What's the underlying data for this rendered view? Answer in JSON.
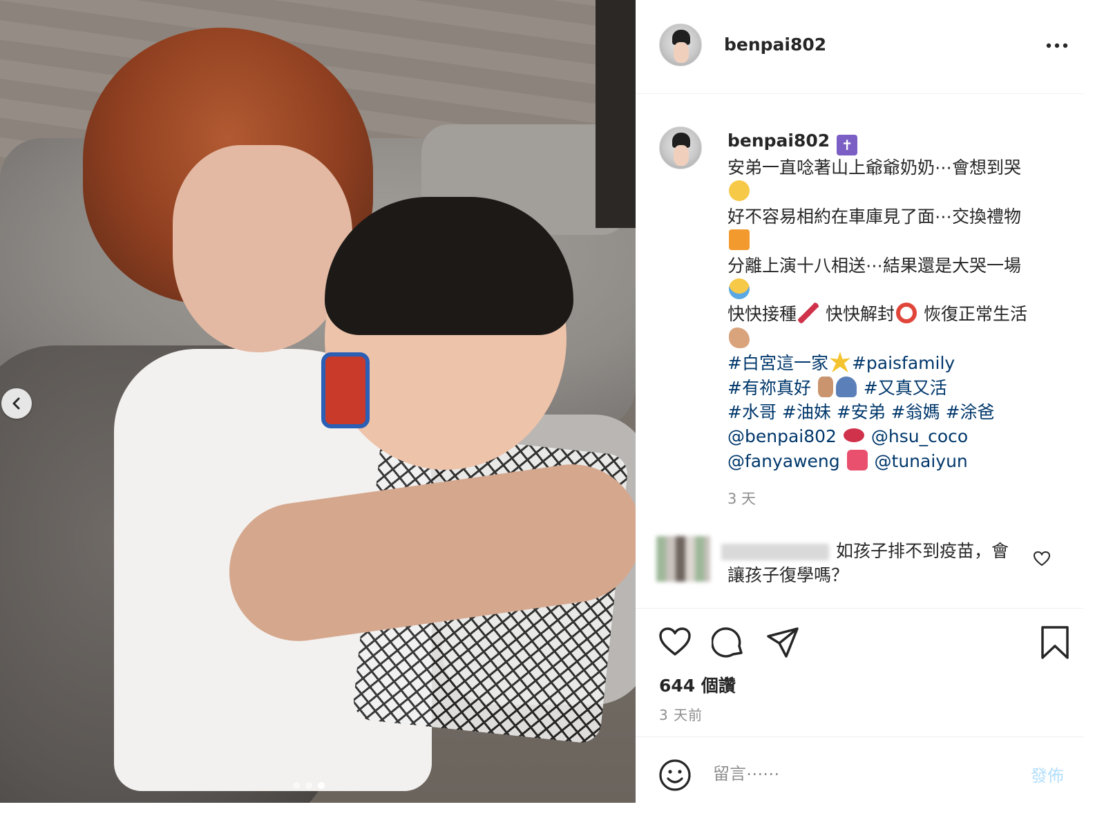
{
  "post": {
    "username": "benpai802",
    "more_label": "•••",
    "caption_lines": [
      "安弟一直唸著山上爺爺奶奶⋯會想到哭",
      "好不容易相約在車庫見了面⋯交換禮物",
      "分離上演十八相送⋯結果還是大哭一場",
      "快快接種",
      "快快解封",
      "恢復正常生活"
    ],
    "hashtags": {
      "line1a": "#白宮這一家",
      "line1b": "#paisfamily",
      "line2a": "#有祢真好",
      "line2b": "#又真又活",
      "line3": "#水哥 #油妹 #安弟 #翁媽 #涂爸"
    },
    "mentions": {
      "m1": "@benpai802",
      "m2": "@hsu_coco",
      "m3": "@fanyaweng",
      "m4": "@tunaiyun"
    },
    "caption_time": "3 天",
    "comment": {
      "text": "如孩子排不到疫苗，會讓孩子復學嗎？"
    },
    "likes": "644 個讚",
    "date": "3 天前",
    "comment_placeholder": "留言⋯⋯",
    "post_button": "發佈"
  },
  "carousel": {
    "total": 3,
    "current": 3
  },
  "icons": {
    "prev": "chevron-left-icon",
    "like": "heart-icon",
    "comment": "comment-icon",
    "share": "paper-plane-icon",
    "save": "bookmark-icon",
    "emoji": "smile-icon",
    "more": "more-dots-icon"
  },
  "colors": {
    "link": "#00376b",
    "muted": "#8e8e8e",
    "post_button_disabled": "#b2dffc",
    "divider": "#efefef"
  }
}
